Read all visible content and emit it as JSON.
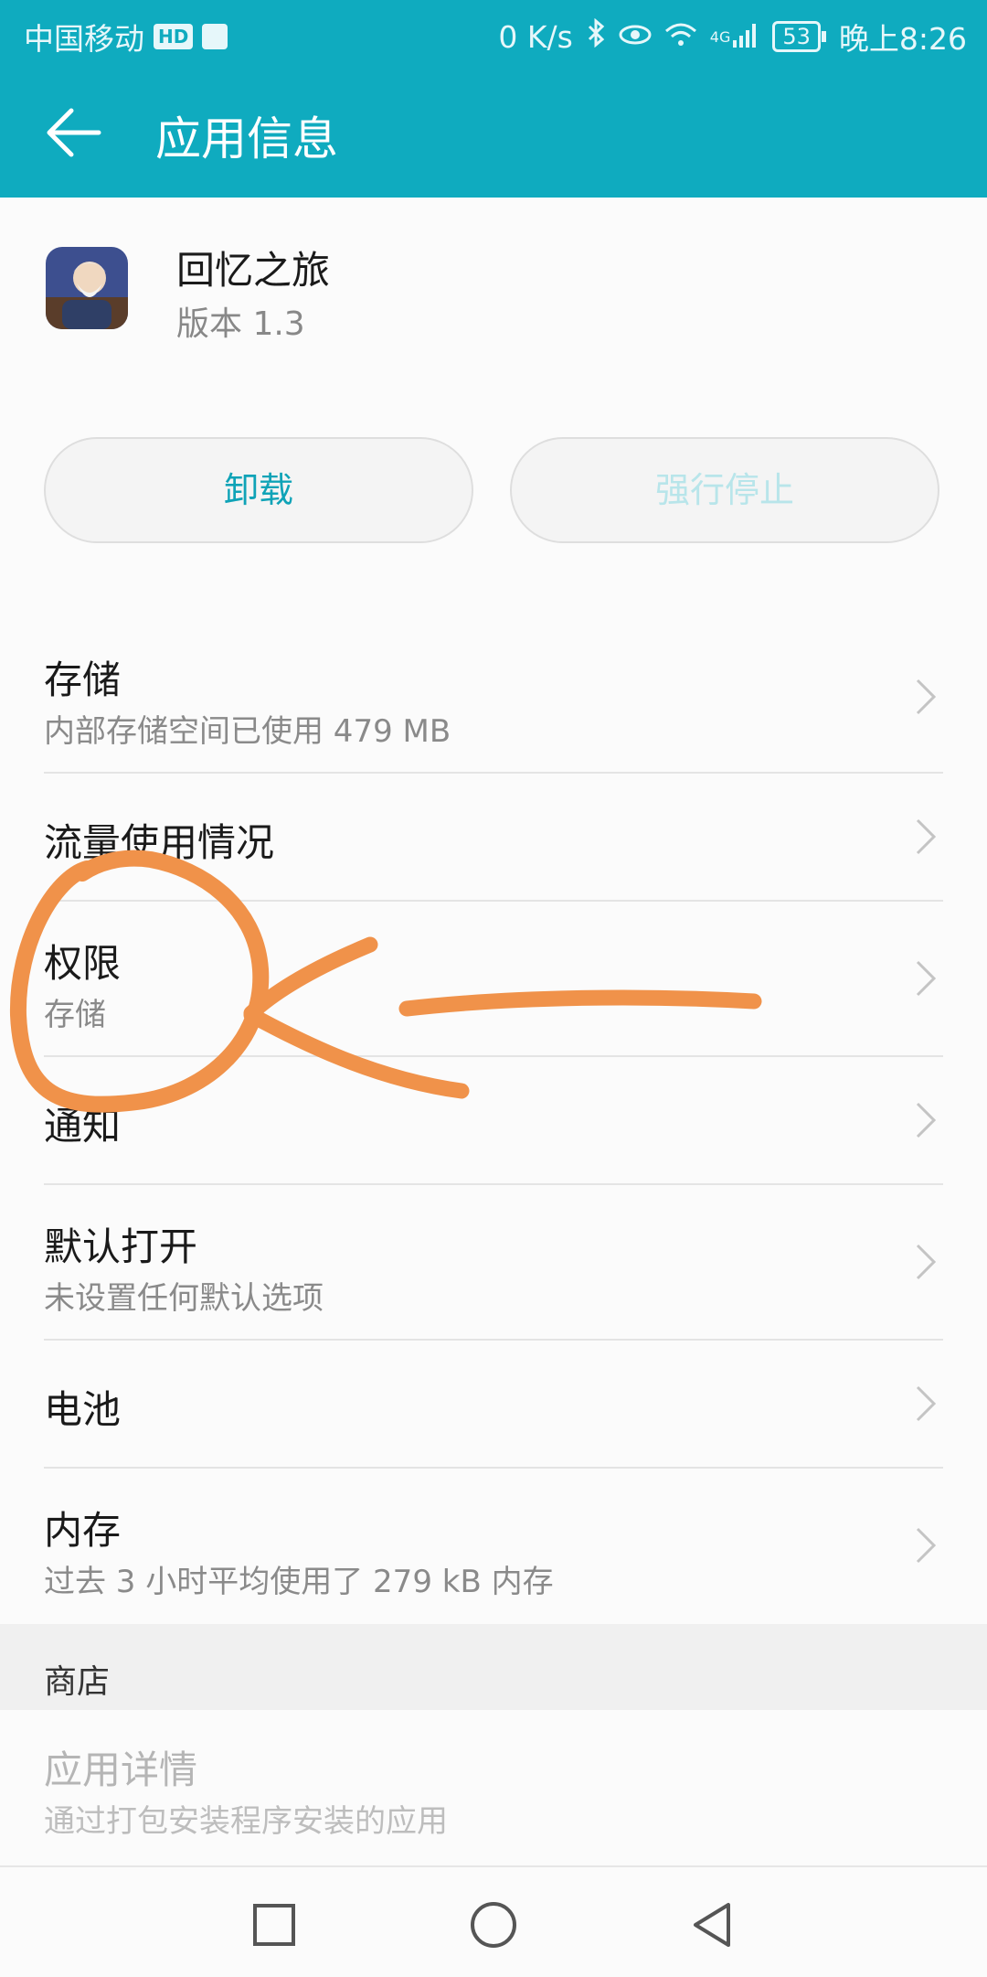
{
  "status_bar": {
    "carrier": "中国移动",
    "hd": "HD",
    "speed": "0 K/s",
    "network": "4G",
    "battery": "53",
    "time": "晚上8:26"
  },
  "header": {
    "title": "应用信息"
  },
  "app": {
    "name": "回忆之旅",
    "version": "版本 1.3"
  },
  "buttons": {
    "uninstall": "卸载",
    "force_stop": "强行停止"
  },
  "settings": [
    {
      "title": "存储",
      "subtitle": "内部存储空间已使用 479 MB"
    },
    {
      "title": "流量使用情况"
    },
    {
      "title": "权限",
      "subtitle": "存储"
    },
    {
      "title": "通知"
    },
    {
      "title": "默认打开",
      "subtitle": "未设置任何默认选项"
    },
    {
      "title": "电池"
    },
    {
      "title": "内存",
      "subtitle": "过去 3 小时平均使用了 279 kB 内存"
    }
  ],
  "store": {
    "section_title": "商店",
    "item_title": "应用详情",
    "item_subtitle": "通过打包安装程序安装的应用"
  },
  "colors": {
    "accent": "#0fabbf",
    "annotation": "#f0924a"
  }
}
